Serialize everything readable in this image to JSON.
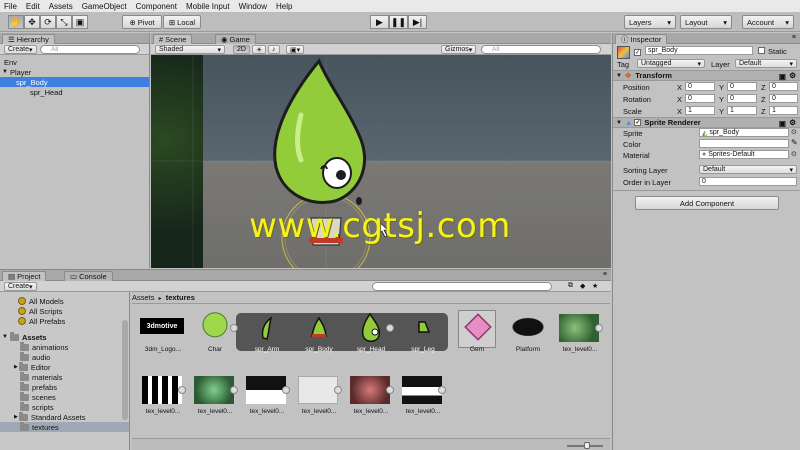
{
  "menu": [
    "File",
    "Edit",
    "Assets",
    "GameObject",
    "Component",
    "Mobile Input",
    "Window",
    "Help"
  ],
  "toolbar": {
    "pivot": "Pivot",
    "local": "Local",
    "layers": "Layers",
    "layout": "Layout",
    "account": "Account"
  },
  "hierarchy": {
    "tab": "Hierarchy",
    "create": "Create",
    "search_placeholder": "All",
    "items": [
      "Env",
      "Player",
      "spr_Body",
      "spr_Head"
    ]
  },
  "scene": {
    "tab_scene": "Scene",
    "tab_game": "Game",
    "shading": "Shaded",
    "mode2d": "2D",
    "gizmos": "Gizmos",
    "search_placeholder": "All"
  },
  "watermark": "www.cgtsj.com",
  "inspector": {
    "tab": "Inspector",
    "name": "spr_Body",
    "static": "Static",
    "tag_label": "Tag",
    "tag": "Untagged",
    "layer_label": "Layer",
    "layer": "Default",
    "transform": {
      "title": "Transform",
      "rows": [
        {
          "label": "Position",
          "x": "0",
          "y": "0",
          "z": "0"
        },
        {
          "label": "Rotation",
          "x": "0",
          "y": "0",
          "z": "0"
        },
        {
          "label": "Scale",
          "x": "1",
          "y": "1",
          "z": "1"
        }
      ],
      "axis": [
        "X",
        "Y",
        "Z"
      ]
    },
    "sprite_renderer": {
      "title": "Sprite Renderer",
      "sprite_label": "Sprite",
      "sprite": "spr_Body",
      "color_label": "Color",
      "material_label": "Material",
      "material": "Sprites-Default",
      "sorting_layer_label": "Sorting Layer",
      "sorting_layer": "Default",
      "order_label": "Order in Layer",
      "order": "0"
    },
    "add_component": "Add Component"
  },
  "project": {
    "tab_project": "Project",
    "tab_console": "Console",
    "create": "Create",
    "favorites": [
      "All Models",
      "All Scripts",
      "All Prefabs"
    ],
    "assets_root": "Assets",
    "folders": [
      "animations",
      "audio",
      "Editor",
      "materials",
      "prefabs",
      "scenes",
      "scripts",
      "Standard Assets",
      "textures"
    ],
    "breadcrumb": [
      "Assets",
      "textures"
    ],
    "row1": [
      "3dm_Logo...",
      "Char",
      "spr_Arm",
      "spr_Body",
      "spr_Head",
      "spr_Leg",
      "Gem",
      "Platform",
      "tex_level0..."
    ],
    "row2": [
      "tex_level0...",
      "tex_level0...",
      "tex_level0...",
      "tex_level0...",
      "tex_level0...",
      "tex_level0..."
    ],
    "logo_text": "3dmotive"
  },
  "colors": {
    "selection": "#3d80df",
    "ground": "#747370",
    "sky": "#4d5a62",
    "character": "#93cc3a",
    "watermark": "#f6f21c"
  }
}
